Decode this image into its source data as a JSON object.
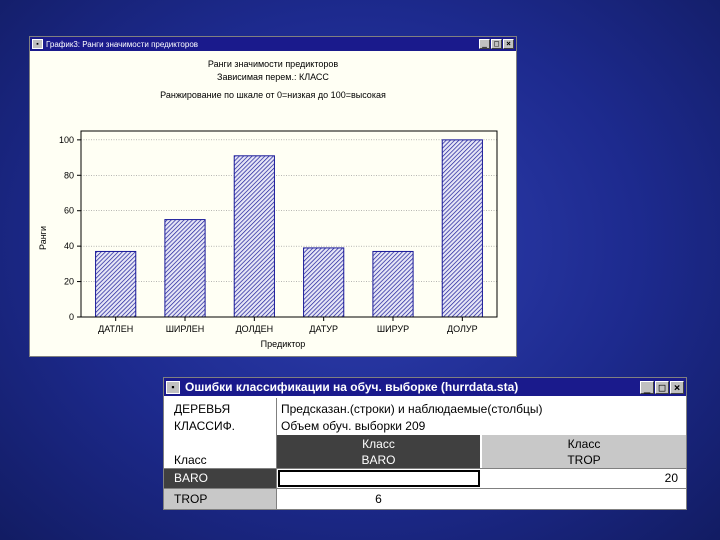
{
  "colors": {
    "desktop": "#1d2a8e",
    "titlebar": "#1a1a8c",
    "bar_edge": "#1a1a99",
    "header_dark": "#404040",
    "header_light": "#c8c8c8"
  },
  "win1": {
    "title": "График3: Ранги значимости предикторов",
    "minimize": "_",
    "maximize": "□",
    "close": "×",
    "chart_data": {
      "type": "bar",
      "title": "Ранги значимости предикторов",
      "subtitle": "Зависимая перем.: КЛАСС",
      "subtitle2": "Ранжирование по шкале от 0=низкая до 100=высокая",
      "xlabel": "Предиктор",
      "ylabel": "Ранги",
      "categories": [
        "ДАТЛЕН",
        "ШИРЛЕН",
        "ДОЛДЕН",
        "ДАТУР",
        "ШИРУР",
        "ДОЛУР"
      ],
      "values": [
        37,
        55,
        91,
        39,
        37,
        100
      ],
      "ylim": [
        0,
        105
      ],
      "yticks": [
        "0",
        "20",
        "40",
        "60",
        "80",
        "100"
      ],
      "grid": true,
      "legend": "none"
    }
  },
  "win2": {
    "title": "Ошибки классификации на обуч. выборке (hurrdata.sta)",
    "minimize": "_",
    "maximize": "□",
    "close": "×",
    "corner_line1": "ДЕРЕВЬЯ",
    "corner_line2": "КЛАССИФ.",
    "info_line1": "Предсказан.(строки) и наблюдаемые(столбцы)",
    "info_line2": "Объем обуч. выборки 209",
    "row_header_label": "Класс",
    "columns": [
      {
        "line1": "Класс",
        "line2": "BARO"
      },
      {
        "line1": "Класс",
        "line2": "TROP"
      }
    ],
    "rows": [
      {
        "label": "BARO",
        "cells": [
          "",
          "20"
        ]
      },
      {
        "label": "TROP",
        "cells": [
          "6",
          ""
        ]
      }
    ]
  }
}
